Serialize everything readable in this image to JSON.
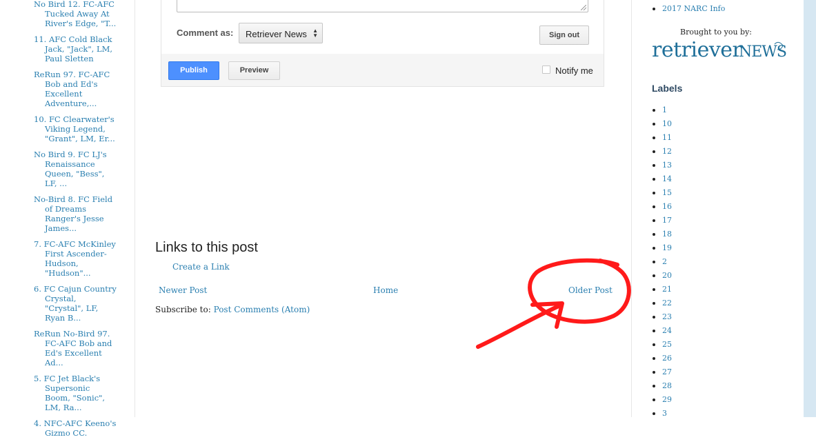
{
  "left_sidebar": {
    "items": [
      "No Bird 12. FC-AFC Tucked Away At River's Edge, \"T...",
      "11. AFC Cold Black Jack, \"Jack\", LM, Paul Sletten",
      "ReRun 97. FC-AFC Bob and Ed's Excellent Adventure,...",
      "10. FC Clearwater's Viking Legend, \"Grant\", LM, Er...",
      "No Bird 9. FC LJ's Renaissance Queen, \"Bess\", LF, ...",
      "No-Bird 8. FC Field of Dreams Ranger's Jesse James...",
      "7. FC-AFC McKinley First Ascender-Hudson, \"Hudson\"...",
      "6. FC Cajun Country Crystal, \"Crystal\", LF, Ryan B...",
      "ReRun No-Bird 97. FC-AFC Bob and Ed's Excellent Ad...",
      "5. FC Jet Black's Supersonic Boom, \"Sonic\", LM, Ra...",
      "4. NFC-AFC Keeno's Gizmo CC."
    ]
  },
  "comment_form": {
    "comment_as_label": "Comment as:",
    "identity_select": "Retriever News",
    "sign_out_label": "Sign out",
    "publish_label": "Publish",
    "preview_label": "Preview",
    "notify_label": "Notify me"
  },
  "links_section": {
    "heading": "Links to this post",
    "create_link": "Create a Link"
  },
  "post_nav": {
    "newer": "Newer Post",
    "home": "Home",
    "older": "Older Post"
  },
  "subscribe": {
    "prefix": "Subscribe to:",
    "link": "Post Comments (Atom)"
  },
  "right_sidebar": {
    "narc_item": "2017 NARC Info",
    "brought_by": "Brought to you by:",
    "logo_text_1": "retriever",
    "logo_text_2": "NEWS",
    "labels_heading": "Labels",
    "labels": [
      "1",
      "10",
      "11",
      "12",
      "13",
      "14",
      "15",
      "16",
      "17",
      "18",
      "19",
      "2",
      "20",
      "21",
      "22",
      "23",
      "24",
      "25",
      "26",
      "27",
      "28",
      "29",
      "3"
    ]
  },
  "colors": {
    "link": "#2a7fb0",
    "annotation": "#ff1a1a",
    "publish": "#4d90fe",
    "logo": "#1f6f99"
  },
  "icons": {
    "select_arrows": "updown-arrows-icon",
    "resize": "resize-grip-icon",
    "annotation": "red-circle-arrow-annotation"
  }
}
